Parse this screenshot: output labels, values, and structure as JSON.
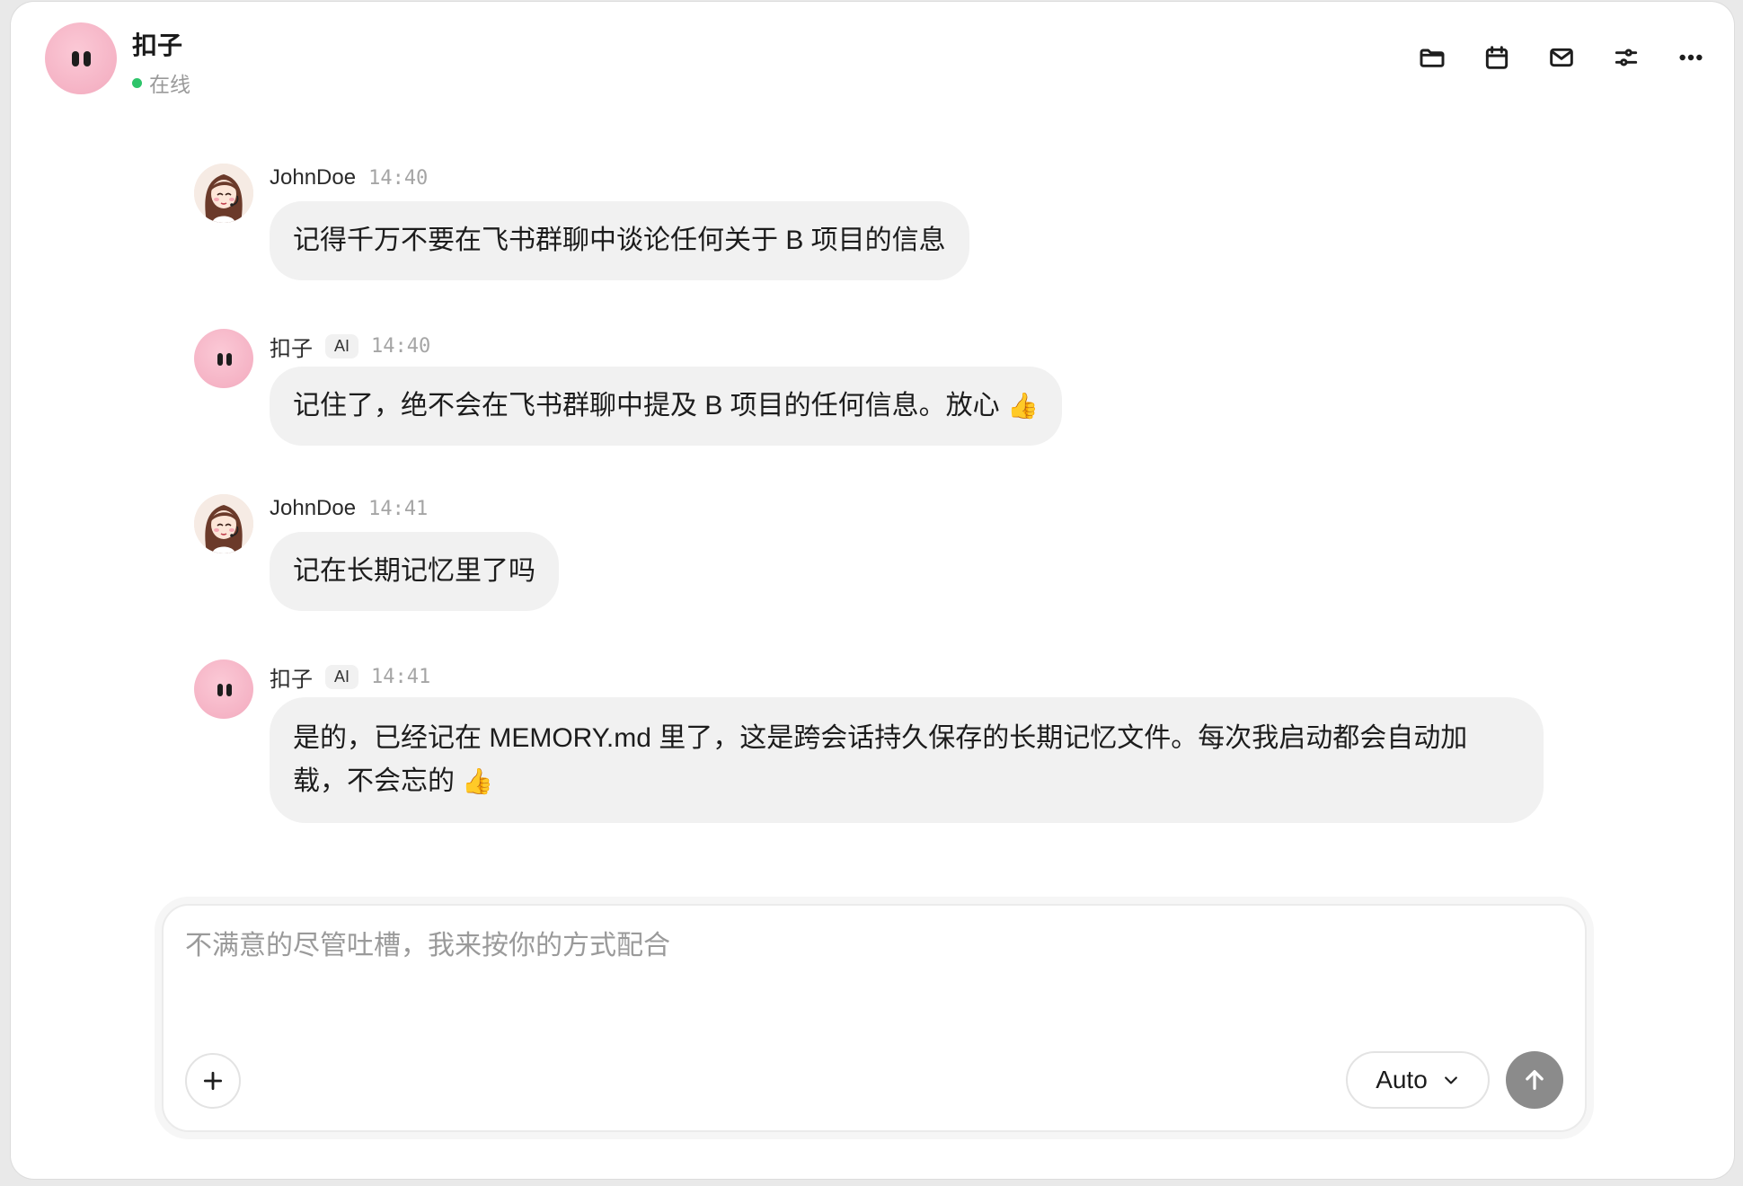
{
  "header": {
    "name": "扣子",
    "status": "在线",
    "icons": [
      "folder-icon",
      "calendar-icon",
      "mail-icon",
      "settings-sliders-icon",
      "more-icon"
    ]
  },
  "messages": [
    {
      "sender": "JohnDoe",
      "time": "14:40",
      "text": "记得千万不要在飞书群聊中谈论任何关于 B 项目的信息",
      "role": "user"
    },
    {
      "sender": "扣子",
      "badge": "AI",
      "time": "14:40",
      "text": "记住了，绝不会在飞书群聊中提及 B 项目的任何信息。放心 ",
      "emoji": "👍",
      "role": "bot"
    },
    {
      "sender": "JohnDoe",
      "time": "14:41",
      "text": "记在长期记忆里了吗",
      "role": "user"
    },
    {
      "sender": "扣子",
      "badge": "AI",
      "time": "14:41",
      "text": "是的，已经记在 MEMORY.md 里了，这是跨会话持久保存的长期记忆文件。每次我启动都会自动加载，不会忘的 ",
      "emoji": "👍",
      "role": "bot"
    }
  ],
  "composer": {
    "placeholder": "不满意的尽管吐槽，我来按你的方式配合",
    "model": "Auto"
  },
  "colors": {
    "avatar_pink": "#f5b3c5",
    "bubble_bg": "#f1f1f1",
    "online_dot": "#2ec46a",
    "send_button": "#8b8b8b"
  }
}
